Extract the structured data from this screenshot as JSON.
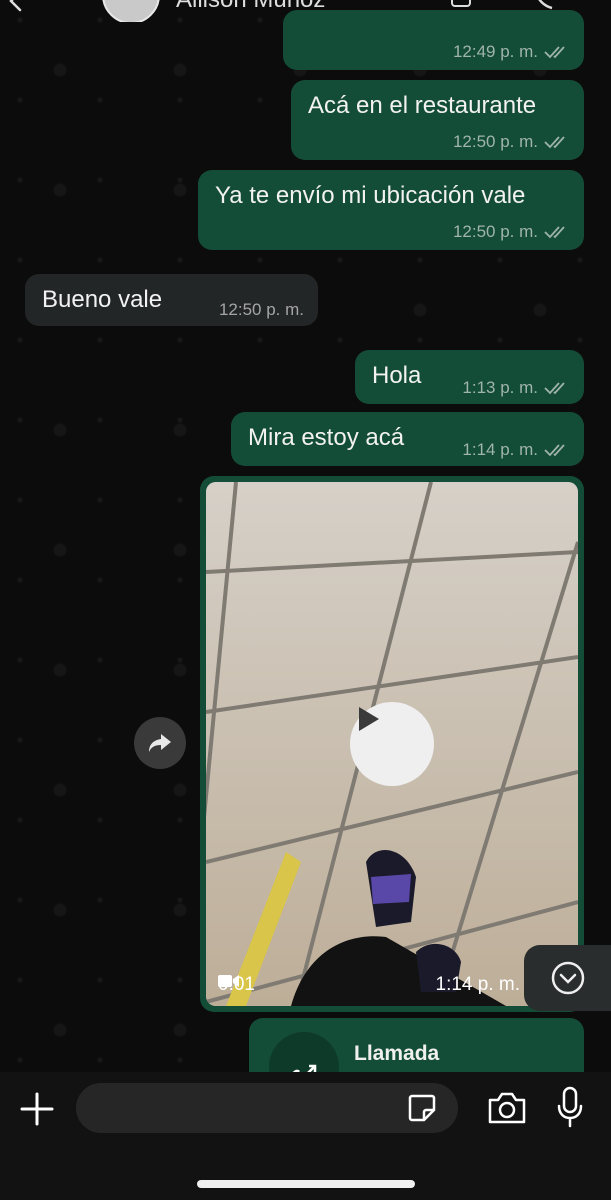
{
  "header": {
    "contact_name": "Allison Muñoz"
  },
  "messages": [
    {
      "id": "m1",
      "direction": "out",
      "text": "",
      "time": "12:49 p. m.",
      "status": "read"
    },
    {
      "id": "m2",
      "direction": "out",
      "text": "Acá en el restaurante",
      "time": "12:50 p. m.",
      "status": "read"
    },
    {
      "id": "m3",
      "direction": "out",
      "text": "Ya te envío mi ubicación vale",
      "time": "12:50 p. m.",
      "status": "read"
    },
    {
      "id": "m4",
      "direction": "in",
      "text": "Bueno vale",
      "time": "12:50 p. m."
    },
    {
      "id": "m5",
      "direction": "out",
      "text": "Hola",
      "time": "1:13 p. m.",
      "status": "read"
    },
    {
      "id": "m6",
      "direction": "out",
      "text": "Mira estoy acá",
      "time": "1:14 p. m.",
      "status": "read"
    }
  ],
  "video_message": {
    "duration": "0:01",
    "time": "1:14 p. m."
  },
  "call_message": {
    "label": "Llamada"
  },
  "composer": {
    "placeholder": ""
  },
  "colors": {
    "outgoing_bubble": "#144d37",
    "incoming_bubble": "#232626",
    "read_ticks": "#9fb4aa"
  }
}
